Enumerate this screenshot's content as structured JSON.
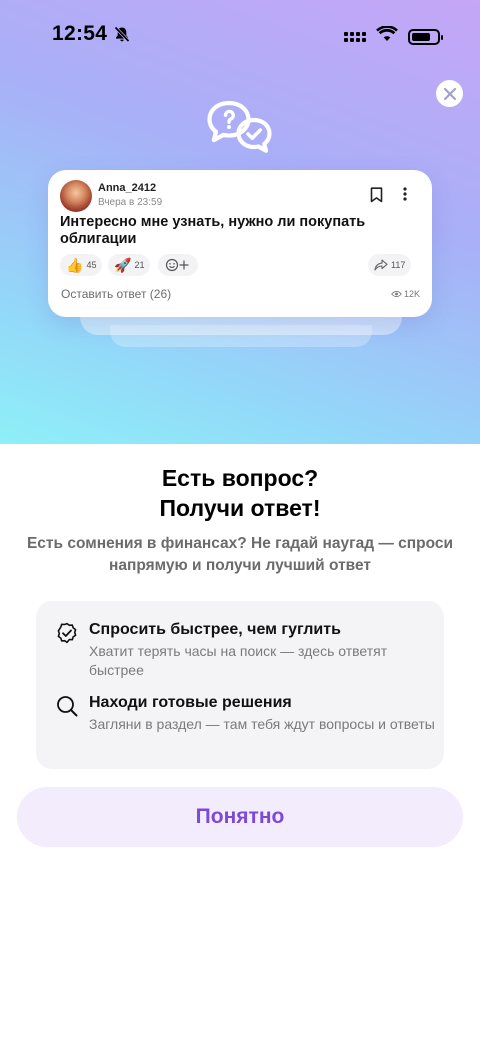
{
  "status_bar": {
    "time": "12:54"
  },
  "post_card": {
    "author": "Anna_2412",
    "date": "Вчера в 23:59",
    "title": "Интересно мне узнать, нужно ли покупать облигации",
    "reactions": [
      {
        "icon": "thumbs-up-icon",
        "emoji": "👍",
        "count": "45"
      },
      {
        "icon": "rocket-icon",
        "emoji": "🚀",
        "count": "21"
      }
    ],
    "shares": "117",
    "leave_answer": "Оставить ответ (26)",
    "views": "12K"
  },
  "headline": {
    "line1": "Есть вопрос?",
    "line2": "Получи ответ!"
  },
  "subtitle": "Есть сомнения в финансах? Не гадай наугад — спроси напрямую и получи лучший ответ",
  "features": [
    {
      "icon": "check-circle-icon",
      "title": "Спросить быстрее, чем гуглить",
      "description": "Хватит терять часы на поиск — здесь ответят быстрее"
    },
    {
      "icon": "search-icon",
      "title": "Находи готовые решения",
      "description": "Загляни в раздел — там тебя ждут вопросы и ответы"
    }
  ],
  "button_label": "Понятно",
  "colors": {
    "accent": "#7c4ad8",
    "button_bg": "#f3ecfd"
  }
}
